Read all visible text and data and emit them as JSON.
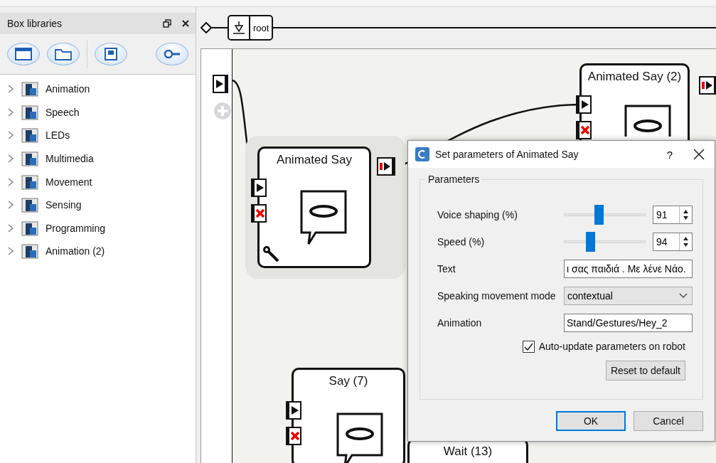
{
  "panel": {
    "title": "Box libraries",
    "items": [
      {
        "label": "Animation",
        "expanded": false
      },
      {
        "label": "Speech",
        "expanded": false
      },
      {
        "label": "LEDs",
        "expanded": false
      },
      {
        "label": "Multimedia",
        "expanded": false
      },
      {
        "label": "Movement",
        "expanded": false
      },
      {
        "label": "Sensing",
        "expanded": false
      },
      {
        "label": "Programming",
        "expanded": false
      },
      {
        "label": "Animation (2)",
        "expanded": false
      }
    ]
  },
  "path": {
    "label": "root"
  },
  "diagram": {
    "boxes": [
      {
        "title": "Animated Say",
        "selected": true
      },
      {
        "title": "Animated Say (2)",
        "selected": false
      },
      {
        "title": "Say (7)",
        "selected": false
      },
      {
        "title": "Wait (13)",
        "selected": false
      }
    ]
  },
  "dialog": {
    "title": "Set parameters of Animated Say",
    "help": "?",
    "group": "Parameters",
    "params": [
      {
        "kind": "slider",
        "label": "Voice shaping (%)",
        "level": 0.42,
        "value": "91"
      },
      {
        "kind": "slider",
        "label": "Speed (%)",
        "level": 0.3,
        "value": "94"
      },
      {
        "kind": "text",
        "label": "Text",
        "value": "ι σας παιδιά . Με λένε Νάο."
      },
      {
        "kind": "combo",
        "label": "Speaking movement mode",
        "value": "contextual"
      },
      {
        "kind": "text",
        "label": "Animation",
        "value": "Stand/Gestures/Hey_2"
      }
    ],
    "auto_update": {
      "label": "Auto-update parameters on robot",
      "checked": true
    },
    "reset": "Reset to default",
    "buttons": [
      {
        "label": "OK",
        "default": true
      },
      {
        "label": "Cancel",
        "default": false
      }
    ]
  }
}
